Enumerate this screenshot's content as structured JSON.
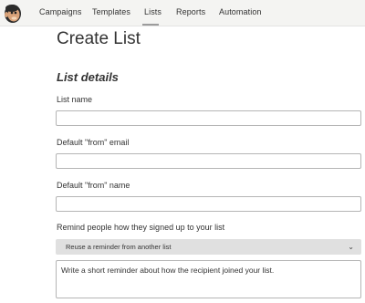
{
  "nav": {
    "logo": "mailchimp-freddie-icon",
    "items": [
      {
        "label": "Campaigns"
      },
      {
        "label": "Templates"
      },
      {
        "label": "Lists",
        "active": true
      },
      {
        "label": "Reports"
      },
      {
        "label": "Automation"
      }
    ]
  },
  "page": {
    "title": "Create List",
    "section_title": "List details"
  },
  "form": {
    "list_name": {
      "label": "List name",
      "value": ""
    },
    "from_email": {
      "label": "Default \"from\" email",
      "value": ""
    },
    "from_name": {
      "label": "Default \"from\" name",
      "value": ""
    },
    "reminder": {
      "label": "Remind people how they signed up to your list",
      "select_value": "Reuse a reminder from another list",
      "textarea_text": "Write a short reminder about how the recipient joined your list."
    }
  }
}
